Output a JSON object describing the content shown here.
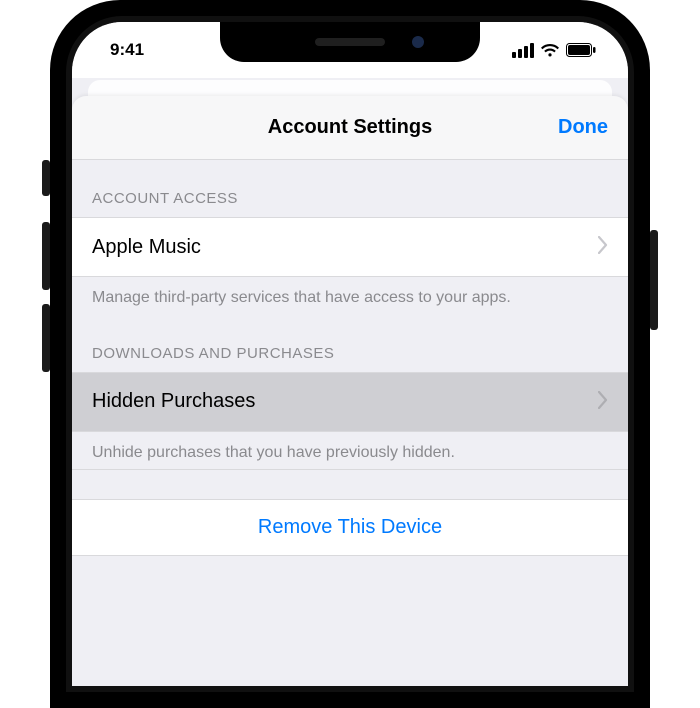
{
  "status": {
    "time": "9:41"
  },
  "nav": {
    "title": "Account Settings",
    "done": "Done"
  },
  "sections": {
    "access": {
      "header": "ACCOUNT ACCESS",
      "row_label": "Apple Music",
      "footer": "Manage third-party services that have access to your apps."
    },
    "downloads": {
      "header": "DOWNLOADS AND PURCHASES",
      "row_label": "Hidden Purchases",
      "footer": "Unhide purchases that you have previously hidden."
    },
    "action": {
      "label": "Remove This Device"
    }
  }
}
